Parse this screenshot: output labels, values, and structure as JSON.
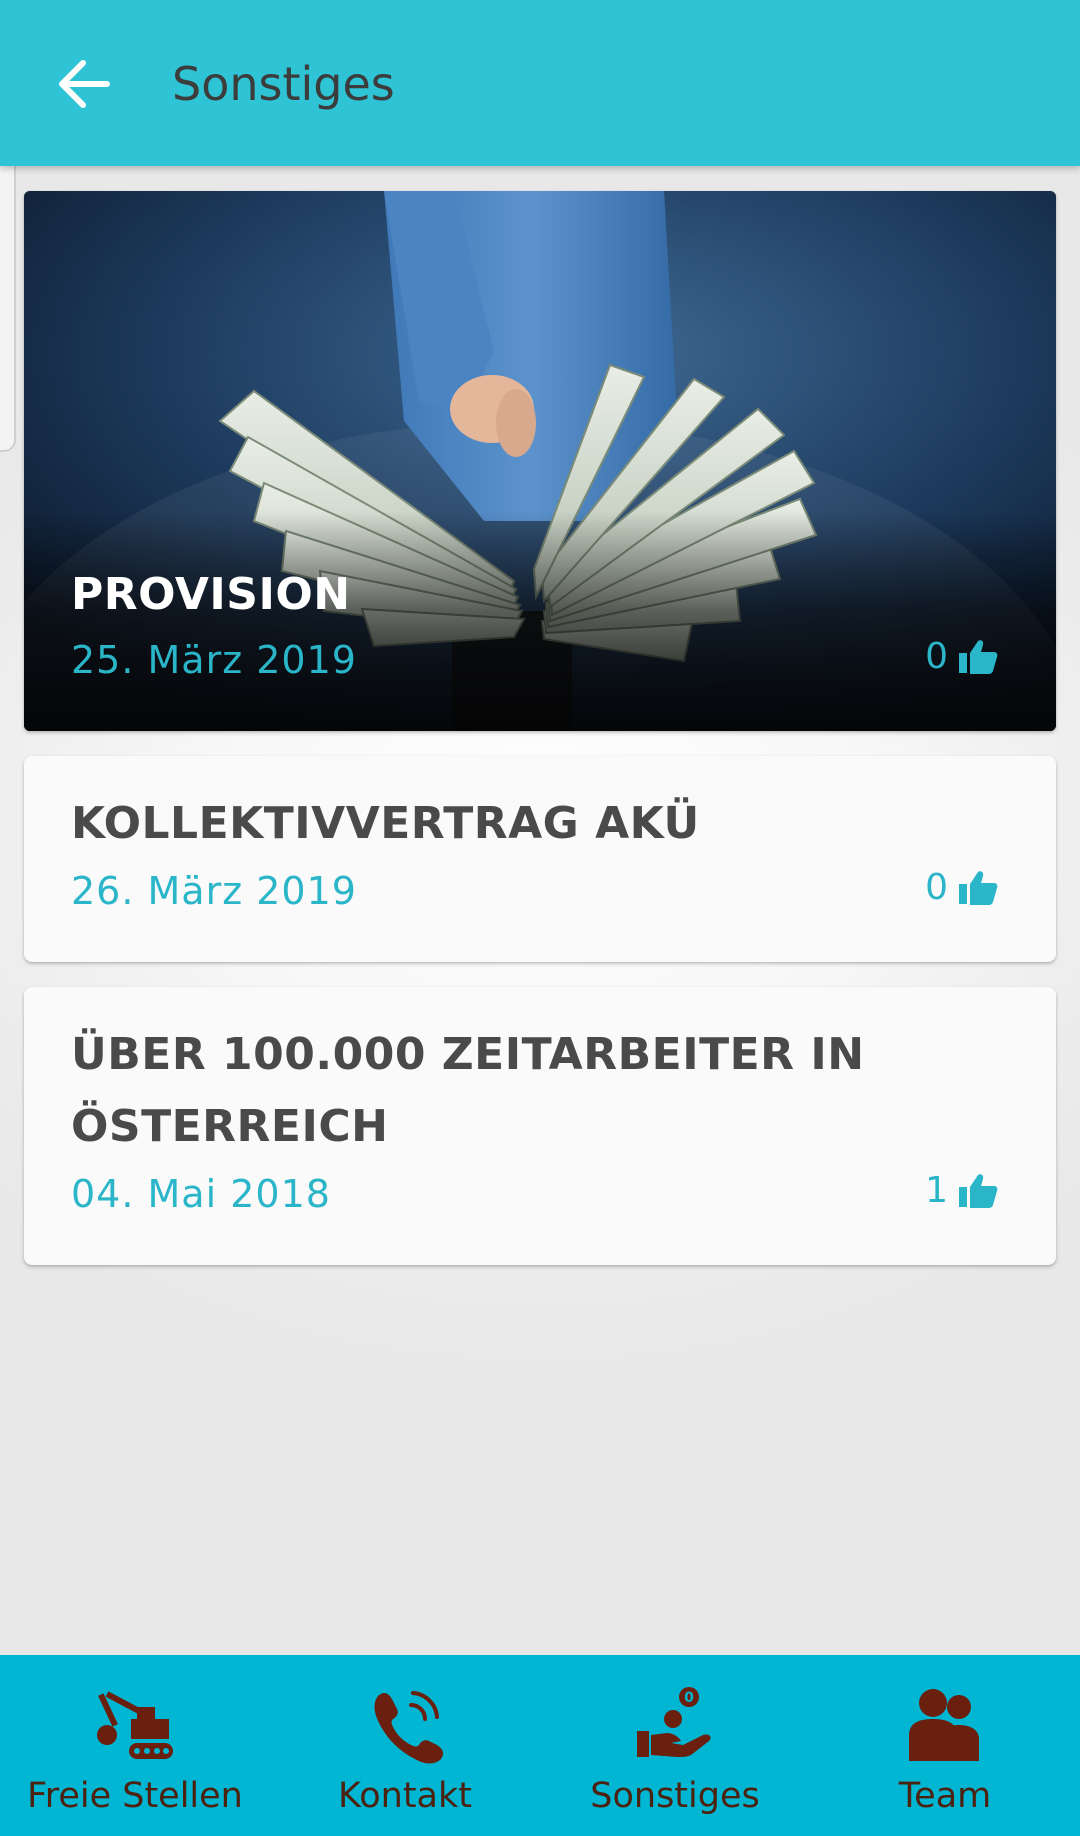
{
  "header": {
    "title": "Sonstiges",
    "background_color": "#2ec3d5",
    "back_icon": "arrow-left-icon"
  },
  "posts": [
    {
      "title": "PROVISION",
      "date": "25. März 2019",
      "likes": "0",
      "image": "hand-holding-dollar-bills-photo"
    },
    {
      "title": "KOLLEKTIVVERTRAG AKÜ",
      "date": "26. März 2019",
      "likes": "0"
    },
    {
      "title": "ÜBER 100.000 ZEITARBEITER IN ÖSTERREICH",
      "date": "04. Mai 2018",
      "likes": "1"
    }
  ],
  "like_icon": "thumbs-up-icon",
  "bottom_nav": {
    "background_color": "#00b6d2",
    "icon_color": "#6b1f0e",
    "items": [
      {
        "label": "Freie Stellen",
        "icon": "excavator-icon"
      },
      {
        "label": "Kontakt",
        "icon": "phone-icon"
      },
      {
        "label": "Sonstiges",
        "icon": "hand-coin-icon"
      },
      {
        "label": "Team",
        "icon": "team-icon"
      }
    ]
  },
  "colors": {
    "accent": "#2ab5c9",
    "title_text": "#4a4a4a"
  }
}
